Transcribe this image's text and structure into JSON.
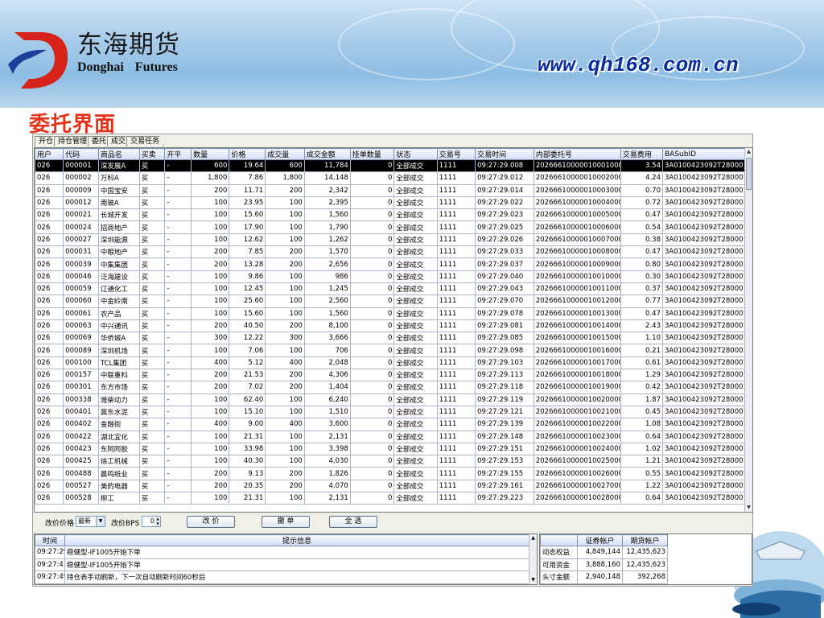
{
  "banner": {
    "brand_cn": "东海期货",
    "brand_en": "Donghai Futures",
    "url": "www.qh168.com.cn",
    "logo_icon": "donghai-d-logo-icon"
  },
  "heading": "委托界面",
  "tabs": [
    "开仓",
    "持仓管理",
    "委托",
    "成交",
    "交易任务"
  ],
  "grid": {
    "columns": [
      "用户",
      "代码",
      "商品名",
      "买卖",
      "开平",
      "数量",
      "价格",
      "成交量",
      "成交金额",
      "挂单数量",
      "状态",
      "交易号",
      "交易时间",
      "内部委托号",
      "交易费用",
      "BASubID"
    ],
    "rows": [
      [
        "026",
        "000001",
        "深发展A",
        "买",
        "-",
        "600",
        "19.64",
        "600",
        "11,784",
        "0",
        "全部成交",
        "1111",
        "09:27:29.008",
        "20266610000010001000",
        "3.54",
        "3A0100423092T280001M"
      ],
      [
        "026",
        "000002",
        "万科A",
        "买",
        "-",
        "1,800",
        "7.86",
        "1,800",
        "14,148",
        "0",
        "全部成交",
        "1111",
        "09:27:29.012",
        "20266610000010002000",
        "4.24",
        "3A0100423092T280001M"
      ],
      [
        "026",
        "000009",
        "中国宝安",
        "买",
        "-",
        "200",
        "11.71",
        "200",
        "2,342",
        "0",
        "全部成交",
        "1111",
        "09:27:29.014",
        "20266610000010003000",
        "0.70",
        "3A0100423092T280001M"
      ],
      [
        "026",
        "000012",
        "南玻A",
        "买",
        "-",
        "100",
        "23.95",
        "100",
        "2,395",
        "0",
        "全部成交",
        "1111",
        "09:27:29.022",
        "20266610000010004000",
        "0.72",
        "3A0100423092T280001M"
      ],
      [
        "026",
        "000021",
        "长城开发",
        "买",
        "-",
        "100",
        "15.60",
        "100",
        "1,560",
        "0",
        "全部成交",
        "1111",
        "09:27:29.023",
        "20266610000010005000",
        "0.47",
        "3A0100423092T280001M"
      ],
      [
        "026",
        "000024",
        "招商地产",
        "买",
        "-",
        "100",
        "17.90",
        "100",
        "1,790",
        "0",
        "全部成交",
        "1111",
        "09:27:29.025",
        "20266610000010006000",
        "0.54",
        "3A0100423092T280001M"
      ],
      [
        "026",
        "000027",
        "深圳能源",
        "买",
        "-",
        "100",
        "12.62",
        "100",
        "1,262",
        "0",
        "全部成交",
        "1111",
        "09:27:29.026",
        "20266610000010007000",
        "0.38",
        "3A0100423092T280001M"
      ],
      [
        "026",
        "000031",
        "中粮地产",
        "买",
        "-",
        "200",
        "7.85",
        "200",
        "1,570",
        "0",
        "全部成交",
        "1111",
        "09:27:29.033",
        "20266610000010008000",
        "0.47",
        "3A0100423092T280001M"
      ],
      [
        "026",
        "000039",
        "中集集团",
        "买",
        "-",
        "200",
        "13.28",
        "200",
        "2,656",
        "0",
        "全部成交",
        "1111",
        "09:27:29.037",
        "20266610000010009000",
        "0.80",
        "3A0100423092T280001M"
      ],
      [
        "026",
        "000046",
        "泛海建设",
        "买",
        "-",
        "100",
        "9.86",
        "100",
        "986",
        "0",
        "全部成交",
        "1111",
        "09:27:29.040",
        "20266610000010010000",
        "0.30",
        "3A0100423092T280001M"
      ],
      [
        "026",
        "000059",
        "辽通化工",
        "买",
        "-",
        "100",
        "12.45",
        "100",
        "1,245",
        "0",
        "全部成交",
        "1111",
        "09:27:29.043",
        "20266610000010011000",
        "0.37",
        "3A0100423092T280001M"
      ],
      [
        "026",
        "000060",
        "中金岭南",
        "买",
        "-",
        "100",
        "25.60",
        "100",
        "2,560",
        "0",
        "全部成交",
        "1111",
        "09:27:29.070",
        "20266610000010012000",
        "0.77",
        "3A0100423092T280001M"
      ],
      [
        "026",
        "000061",
        "农产品",
        "买",
        "-",
        "100",
        "15.60",
        "100",
        "1,560",
        "0",
        "全部成交",
        "1111",
        "09:27:29.078",
        "20266610000010013000",
        "0.47",
        "3A0100423092T280001M"
      ],
      [
        "026",
        "000063",
        "中兴通讯",
        "买",
        "-",
        "200",
        "40.50",
        "200",
        "8,100",
        "0",
        "全部成交",
        "1111",
        "09:27:29.081",
        "20266610000010014000",
        "2.43",
        "3A0100423092T280001M"
      ],
      [
        "026",
        "000069",
        "华侨城A",
        "买",
        "-",
        "300",
        "12.22",
        "300",
        "3,666",
        "0",
        "全部成交",
        "1111",
        "09:27:29.085",
        "20266610000010015000",
        "1.10",
        "3A0100423092T280001M"
      ],
      [
        "026",
        "000089",
        "深圳机场",
        "买",
        "-",
        "100",
        "7.06",
        "100",
        "706",
        "0",
        "全部成交",
        "1111",
        "09:27:29.098",
        "20266610000010016000",
        "0.21",
        "3A0100423092T280001M"
      ],
      [
        "026",
        "000100",
        "TCL集团",
        "买",
        "-",
        "400",
        "5.12",
        "400",
        "2,048",
        "0",
        "全部成交",
        "1111",
        "09:27:29.103",
        "20266610000010017000",
        "0.61",
        "3A0100423092T280001M"
      ],
      [
        "026",
        "000157",
        "中联重科",
        "买",
        "-",
        "200",
        "21.53",
        "200",
        "4,306",
        "0",
        "全部成交",
        "1111",
        "09:27:29.113",
        "20266610000010018000",
        "1.29",
        "3A0100423092T280001M"
      ],
      [
        "026",
        "000301",
        "东方市场",
        "买",
        "-",
        "200",
        "7.02",
        "200",
        "1,404",
        "0",
        "全部成交",
        "1111",
        "09:27:29.118",
        "20266610000010019000",
        "0.42",
        "3A0100423092T280001M"
      ],
      [
        "026",
        "000338",
        "潍柴动力",
        "买",
        "-",
        "100",
        "62.40",
        "100",
        "6,240",
        "0",
        "全部成交",
        "1111",
        "09:27:29.119",
        "20266610000010020000",
        "1.87",
        "3A0100423092T280001M"
      ],
      [
        "026",
        "000401",
        "冀东水泥",
        "买",
        "-",
        "100",
        "15.10",
        "100",
        "1,510",
        "0",
        "全部成交",
        "1111",
        "09:27:29.121",
        "20266610000010021000",
        "0.45",
        "3A0100423092T280001M"
      ],
      [
        "026",
        "000402",
        "金融街",
        "买",
        "-",
        "400",
        "9.00",
        "400",
        "3,600",
        "0",
        "全部成交",
        "1111",
        "09:27:29.139",
        "20266610000010022000",
        "1.08",
        "3A0100423092T280001M"
      ],
      [
        "026",
        "000422",
        "湖北宜化",
        "买",
        "-",
        "100",
        "21.31",
        "100",
        "2,131",
        "0",
        "全部成交",
        "1111",
        "09:27:29.148",
        "20266610000010023000",
        "0.64",
        "3A0100423092T280001M"
      ],
      [
        "026",
        "000423",
        "东阿阿胶",
        "买",
        "-",
        "100",
        "33.98",
        "100",
        "3,398",
        "0",
        "全部成交",
        "1111",
        "09:27:29.151",
        "20266610000010024000",
        "1.02",
        "3A0100423092T280001M"
      ],
      [
        "026",
        "000425",
        "徐工机械",
        "买",
        "-",
        "100",
        "40.30",
        "100",
        "4,030",
        "0",
        "全部成交",
        "1111",
        "09:27:29.153",
        "20266610000010025000",
        "1.21",
        "3A0100423092T280001M"
      ],
      [
        "026",
        "000488",
        "晨鸣纸业",
        "买",
        "-",
        "200",
        "9.13",
        "200",
        "1,826",
        "0",
        "全部成交",
        "1111",
        "09:27:29.155",
        "20266610000010026000",
        "0.55",
        "3A0100423092T280001M"
      ],
      [
        "026",
        "000527",
        "美的电器",
        "买",
        "-",
        "200",
        "20.35",
        "200",
        "4,070",
        "0",
        "全部成交",
        "1111",
        "09:27:29.161",
        "20266610000010027000",
        "1.22",
        "3A0100423092T280001M"
      ],
      [
        "026",
        "000528",
        "柳工",
        "买",
        "-",
        "100",
        "21.31",
        "100",
        "2,131",
        "0",
        "全部成交",
        "1111",
        "09:27:29.223",
        "20266610000010028000",
        "0.64",
        "3A0100423092T280001M"
      ]
    ]
  },
  "controls": {
    "price_label": "改价价格",
    "price_value": "最新",
    "bps_label": "改价BPS",
    "bps_value": "0",
    "modify_btn": "改 价",
    "cancel_btn": "撤 单",
    "select_all_btn": "全 选"
  },
  "log": {
    "headers": [
      "时间",
      "提示信息"
    ],
    "rows": [
      [
        "09:27:29",
        "稳健型-IF1005开始下单"
      ],
      [
        "09:27:41",
        "稳健型-IF1005开始下单"
      ],
      [
        "09:27:49",
        "持仓表手动刷新，下一次自动刷新时间60秒后"
      ]
    ]
  },
  "account": {
    "headers": [
      "",
      "证券帐户",
      "期货帐户"
    ],
    "rows": [
      [
        "动态权益",
        "4,849,144",
        "12,435,623"
      ],
      [
        "可用资金",
        "3,888,160",
        "12,435,623"
      ],
      [
        "头寸金额",
        "2,940,148",
        "392,268"
      ]
    ]
  },
  "colors": {
    "heading": "#e5321a",
    "url": "#0a2e9e",
    "logo_red": "#d6241a",
    "selected_row_bg": "#000000"
  }
}
